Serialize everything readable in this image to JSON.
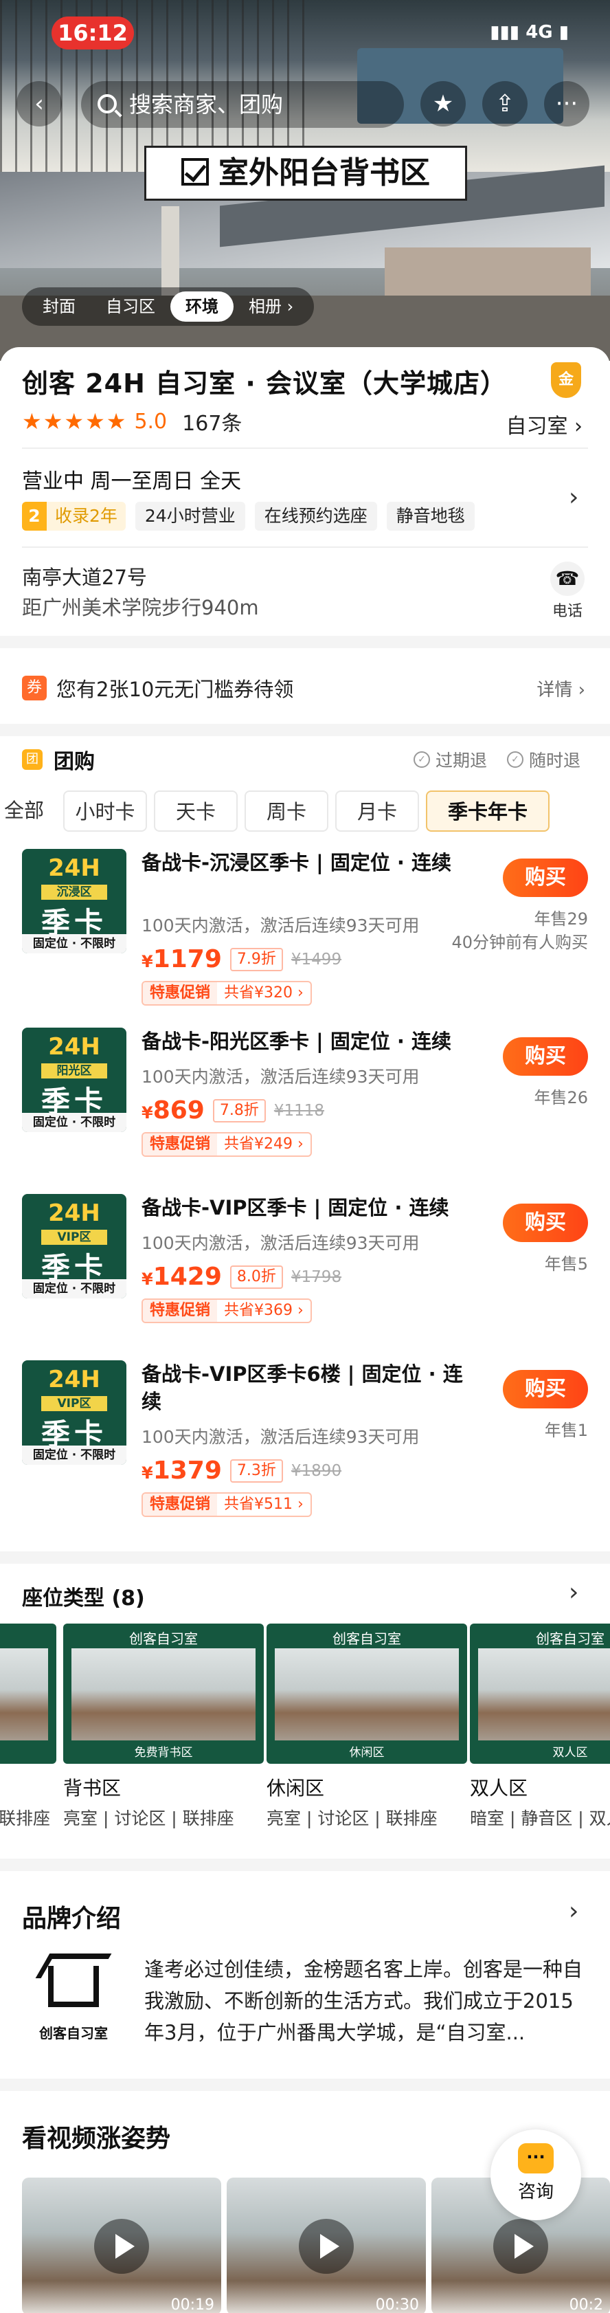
{
  "status_bar": {
    "time": "16:12",
    "network": "4G"
  },
  "nav": {
    "search_placeholder": "搜索商家、团购"
  },
  "hero": {
    "sign": "室外阳台背书区",
    "tabs": [
      "封面",
      "自习区",
      "环境",
      "相册 ›"
    ],
    "active_tab": "环境"
  },
  "store": {
    "title": "创客 24H 自习室 · 会议室（大学城店）",
    "badge": "金",
    "score": "5.0",
    "reviews": "167条",
    "category": "自习室 ›",
    "hours": "营业中   周一至周日 全天",
    "gold_num": "2",
    "gold_text": "收录2年",
    "tags": [
      "24小时营业",
      "在线预约选座",
      "静音地毯"
    ],
    "address": "南亭大道27号",
    "distance": "距广州美术学院步行940m",
    "phone_label": "电话"
  },
  "coupon": {
    "text": "您有2张10元无门槛券待领",
    "detail": "详情 ›"
  },
  "group_buy": {
    "title": "团购",
    "refund_expired": "过期退",
    "refund_anytime": "随时退",
    "filters": [
      "全部",
      "小时卡",
      "天卡",
      "周卡",
      "月卡",
      "季卡年卡"
    ],
    "active_filter": "季卡年卡",
    "deals": [
      {
        "thumb_zone": "沉浸区",
        "name": "备战卡-沉浸区季卡 | 固定位 · 连续",
        "desc": "100天内激活，激活后连续93天可用",
        "price": "1179",
        "discount": "7.9折",
        "orig": "¥1499",
        "promo_tag": "特惠促销",
        "save": "共省¥320 ›",
        "buy": "购买",
        "sold": "年售29",
        "recent": "40分钟前有人购买"
      },
      {
        "thumb_zone": "阳光区",
        "name": "备战卡-阳光区季卡 | 固定位 · 连续",
        "desc": "100天内激活，激活后连续93天可用",
        "price": "869",
        "discount": "7.8折",
        "orig": "¥1118",
        "promo_tag": "特惠促销",
        "save": "共省¥249 ›",
        "buy": "购买",
        "sold": "年售26",
        "recent": ""
      },
      {
        "thumb_zone": "VIP区",
        "name": "备战卡-VIP区季卡 | 固定位 · 连续",
        "desc": "100天内激活，激活后连续93天可用",
        "price": "1429",
        "discount": "8.0折",
        "orig": "¥1798",
        "promo_tag": "特惠促销",
        "save": "共省¥369 ›",
        "buy": "购买",
        "sold": "年售5",
        "recent": ""
      },
      {
        "thumb_zone": "VIP区",
        "name": "备战卡-VIP区季卡6楼 | 固定位 · 连续",
        "desc": "100天内激活，激活后连续93天可用",
        "price": "1379",
        "discount": "7.3折",
        "orig": "¥1890",
        "promo_tag": "特惠促销",
        "save": "共省¥511 ›",
        "buy": "购买",
        "sold": "年售1",
        "recent": ""
      }
    ],
    "thumb_24h": "24H",
    "thumb_season": "季卡",
    "thumb_foot": "固定位 · 不限时"
  },
  "seats": {
    "title": "座位类型 (8)",
    "brand_caption": "创客自习室",
    "items": [
      {
        "name": "",
        "desc": "联排座",
        "cap": ""
      },
      {
        "name": "背书区",
        "desc": "亮室 | 讨论区 | 联排座",
        "cap": "免费背书区"
      },
      {
        "name": "休闲区",
        "desc": "亮室 | 讨论区 | 联排座",
        "cap": "休闲区"
      },
      {
        "name": "双人区",
        "desc": "暗室 | 静音区 | 双人",
        "cap": "双人区"
      }
    ]
  },
  "brand": {
    "title": "品牌介绍",
    "logo_name": "创客自习室",
    "text": "逢考必过创佳绩，金榜题名客上岸。创客是一种自我激励、不断创新的生活方式。我们成立于2015年3月，位于广州番禺大学城，是“自习室..."
  },
  "videos": {
    "title": "看视频涨姿势",
    "items": [
      {
        "dur": "00:19"
      },
      {
        "dur": "00:30"
      },
      {
        "dur": "00:2"
      }
    ],
    "consult": "咨询"
  },
  "colors": {
    "accent": "#ff4a17",
    "gold": "#ffb21a",
    "alert": "#e8322d"
  }
}
